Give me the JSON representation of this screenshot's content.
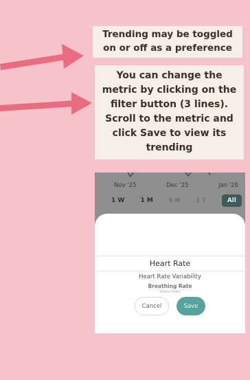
{
  "callouts": {
    "toggle_note": "Trending may be toggled on or off as a preference",
    "metric_note": "You can change the metric by clicking on the filter button (3 lines). Scroll to the metric and click Save to view its trending"
  },
  "phone": {
    "chart_dates": [
      "Nov '25",
      "Dec '25",
      "Jan '26"
    ],
    "ranges": [
      {
        "label": "1 W",
        "state": "normal"
      },
      {
        "label": "1 M",
        "state": "normal"
      },
      {
        "label": "6 M",
        "state": "dim"
      },
      {
        "label": "1 Y",
        "state": "dim"
      },
      {
        "label": "All",
        "state": "active"
      }
    ],
    "picker": {
      "items": [
        "Heart Rate",
        "Heart Rate Variability",
        "Breathing Rate",
        "Stress Index"
      ],
      "selected": "Heart Rate"
    },
    "buttons": {
      "cancel": "Cancel",
      "save": "Save"
    }
  },
  "colors": {
    "background": "#f7c3cb",
    "arrow": "#e96d80",
    "callout_bg": "#f6efe5",
    "save_button": "#5aa39d",
    "active_range": "#3e5a5a"
  }
}
